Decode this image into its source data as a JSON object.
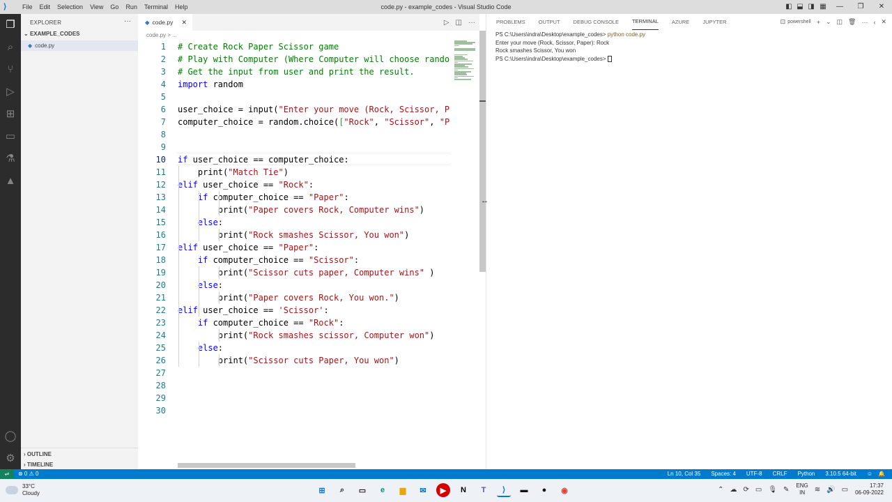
{
  "titlebar": {
    "menu": [
      "File",
      "Edit",
      "Selection",
      "View",
      "Go",
      "Run",
      "Terminal",
      "Help"
    ],
    "window_title": "code.py - example_codes - Visual Studio Code"
  },
  "sidebar": {
    "header": "EXPLORER",
    "folder": "EXAMPLE_CODES",
    "file": "code.py",
    "outline": "OUTLINE",
    "timeline": "TIMELINE"
  },
  "editor": {
    "tab_label": "code.py",
    "breadcrumb": "code.py > ...",
    "current_line": 10,
    "lines": [
      [
        [
          "c-com",
          "# Create Rock Paper Scissor game"
        ]
      ],
      [
        [
          "c-com",
          "# Play with Computer (Where Computer will choose rando"
        ]
      ],
      [
        [
          "c-com",
          "# Get the input from user and print the result."
        ]
      ],
      [
        [
          "c-kw",
          "import"
        ],
        [
          "c-n",
          " random"
        ]
      ],
      [],
      [
        [
          "c-n",
          "user_choice = input("
        ],
        [
          "c-str",
          "\"Enter your move (Rock, Scissor, P"
        ]
      ],
      [
        [
          "c-n",
          "computer_choice = random.choice("
        ],
        [
          "c-br",
          "["
        ],
        [
          "c-str",
          "\"Rock\""
        ],
        [
          "c-n",
          ", "
        ],
        [
          "c-str",
          "\"Scissor\""
        ],
        [
          "c-n",
          ", "
        ],
        [
          "c-str",
          "\"P"
        ]
      ],
      [],
      [],
      [
        [
          "c-kw",
          "if"
        ],
        [
          "c-n",
          " user_choice == computer_choice:"
        ]
      ],
      [
        [
          "c-n",
          "    print("
        ],
        [
          "c-str",
          "\"Match Tie\""
        ],
        [
          "c-n",
          ")"
        ]
      ],
      [
        [
          "c-kw",
          "elif"
        ],
        [
          "c-n",
          " user_choice == "
        ],
        [
          "c-str",
          "\"Rock\""
        ],
        [
          "c-n",
          ":"
        ]
      ],
      [
        [
          "c-kw",
          "    if"
        ],
        [
          "c-n",
          " computer_choice == "
        ],
        [
          "c-str",
          "\"Paper\""
        ],
        [
          "c-n",
          ":"
        ]
      ],
      [
        [
          "c-n",
          "        print("
        ],
        [
          "c-str",
          "\"Paper covers Rock, Computer wins\""
        ],
        [
          "c-n",
          ")"
        ]
      ],
      [
        [
          "c-kw",
          "    else"
        ],
        [
          "c-n",
          ":"
        ]
      ],
      [
        [
          "c-n",
          "        print("
        ],
        [
          "c-str",
          "\"Rock smashes Scissor, You won\""
        ],
        [
          "c-n",
          ")"
        ]
      ],
      [
        [
          "c-kw",
          "elif"
        ],
        [
          "c-n",
          " user_choice == "
        ],
        [
          "c-str",
          "\"Paper\""
        ],
        [
          "c-n",
          ":"
        ]
      ],
      [
        [
          "c-kw",
          "    if"
        ],
        [
          "c-n",
          " computer_choice == "
        ],
        [
          "c-str",
          "\"Scissor\""
        ],
        [
          "c-n",
          ":"
        ]
      ],
      [
        [
          "c-n",
          "        print("
        ],
        [
          "c-str",
          "\"Scissor cuts paper, Computer wins\""
        ],
        [
          "c-n",
          " )"
        ]
      ],
      [
        [
          "c-kw",
          "    else"
        ],
        [
          "c-n",
          ":"
        ]
      ],
      [
        [
          "c-n",
          "        print("
        ],
        [
          "c-str",
          "\"Paper covers Rock, You won.\""
        ],
        [
          "c-n",
          ")"
        ]
      ],
      [
        [
          "c-kw",
          "elif"
        ],
        [
          "c-n",
          " user_choice == "
        ],
        [
          "c-str",
          "'Scissor'"
        ],
        [
          "c-n",
          ":"
        ]
      ],
      [
        [
          "c-kw",
          "    if"
        ],
        [
          "c-n",
          " computer_choice == "
        ],
        [
          "c-str",
          "\"Rock\""
        ],
        [
          "c-n",
          ":"
        ]
      ],
      [
        [
          "c-n",
          "        print("
        ],
        [
          "c-str",
          "\"Rock smashes scissor, Computer won\""
        ],
        [
          "c-n",
          ")"
        ]
      ],
      [
        [
          "c-kw",
          "    else"
        ],
        [
          "c-n",
          ":"
        ]
      ],
      [
        [
          "c-n",
          "        print("
        ],
        [
          "c-str",
          "\"Scissor cuts Paper, You won\""
        ],
        [
          "c-n",
          ")"
        ]
      ],
      [],
      [],
      [],
      []
    ]
  },
  "panel": {
    "tabs": [
      "PROBLEMS",
      "OUTPUT",
      "DEBUG CONSOLE",
      "TERMINAL",
      "AZURE",
      "JUPYTER"
    ],
    "active_tab": "TERMINAL",
    "shell": "powershell",
    "terminal": {
      "line1_prompt": "PS C:\\Users\\indra\\Desktop\\example_codes> ",
      "line1_cmd": "python code.py",
      "line2": "Enter your move (Rock, Scissor, Paper): Rock",
      "line3": "Rock smashes Scissor, You won",
      "line4_prompt": "PS C:\\Users\\indra\\Desktop\\example_codes> "
    }
  },
  "statusbar": {
    "errors": "⊗ 0 ⚠ 0",
    "position": "Ln 10, Col 35",
    "spaces": "Spaces: 4",
    "encoding": "UTF-8",
    "eol": "CRLF",
    "language": "Python",
    "interpreter": "3.10.5 64-bit"
  },
  "taskbar": {
    "temperature": "33°C",
    "weather": "Cloudy",
    "lang_top": "ENG",
    "lang_bottom": "IN",
    "time": "17:37",
    "date": "06-09-2022"
  },
  "colors": {
    "accent": "#007acc",
    "activity_bar": "#2c2c2c",
    "remote": "#16825d"
  }
}
